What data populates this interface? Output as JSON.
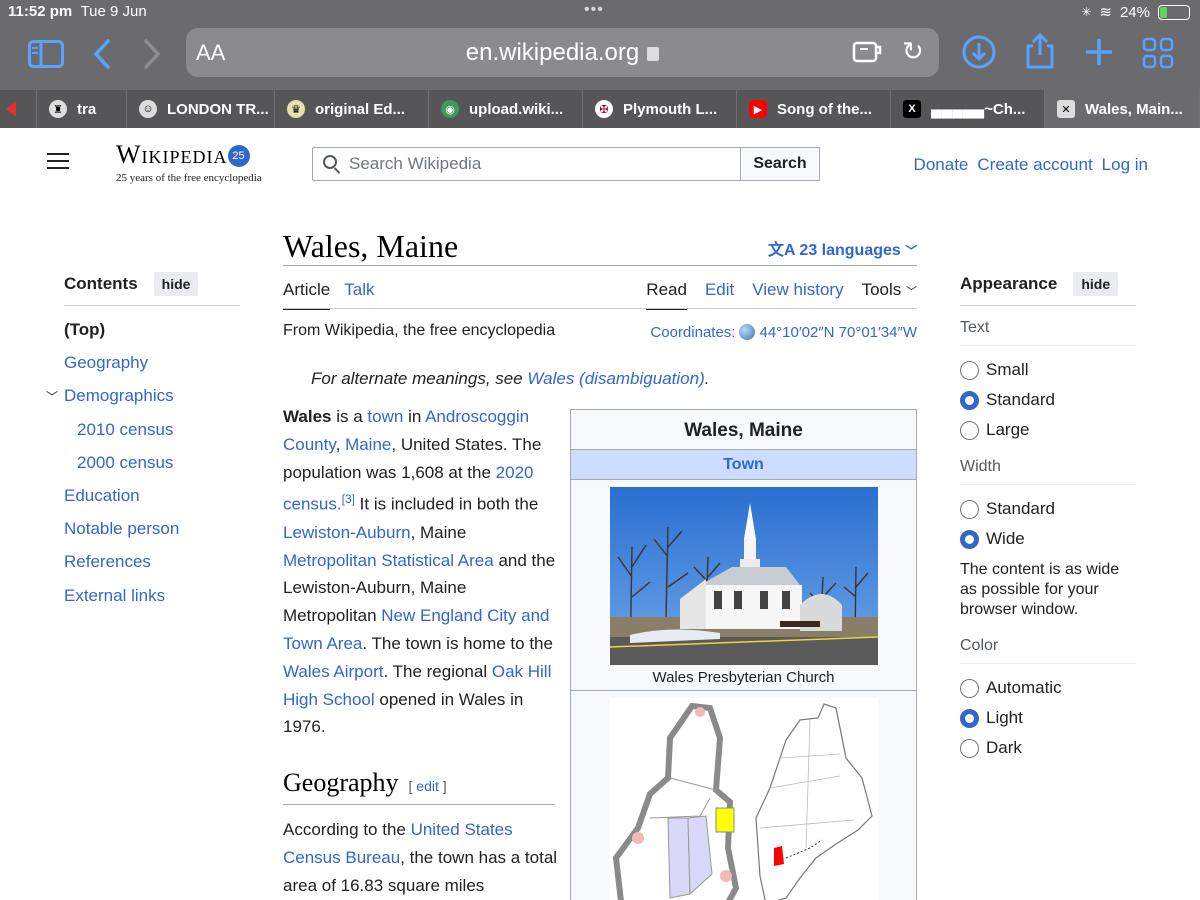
{
  "status": {
    "time": "11:52 pm",
    "date": "Tue 9 Jun",
    "battery": "24%",
    "battery_level": 0.24
  },
  "browser": {
    "aa_label": "AA",
    "url": "en.wikipedia.org",
    "tabs": [
      {
        "label": "tra",
        "icon": "trumpet-icon"
      },
      {
        "label": "LONDON TR...",
        "icon": "smiley-icon"
      },
      {
        "label": "original Ed...",
        "icon": "crest-icon"
      },
      {
        "label": "upload.wiki...",
        "icon": "wikimedia-icon"
      },
      {
        "label": "Plymouth L...",
        "icon": "badge-icon"
      },
      {
        "label": "Song of the...",
        "icon": "youtube-icon"
      },
      {
        "label": "▄▄▄▄▄~Ch...",
        "icon": "x-icon"
      },
      {
        "label": "Wales, Main...",
        "icon": "wikipedia-icon"
      }
    ]
  },
  "header": {
    "logo_word": "Wikipedia",
    "logo_badge": "25",
    "tagline": "25 years of the free encyclopedia",
    "search_placeholder": "Search Wikipedia",
    "search_button": "Search",
    "links": [
      "Donate",
      "Create account",
      "Log in"
    ]
  },
  "toc": {
    "title": "Contents",
    "hide": "hide",
    "items": [
      "(Top)",
      "Geography",
      "Demographics",
      "2010 census",
      "2000 census",
      "Education",
      "Notable person",
      "References",
      "External links"
    ]
  },
  "article": {
    "title": "Wales, Maine",
    "languages": "23 languages",
    "tabs_left": [
      "Article",
      "Talk"
    ],
    "tabs_right": [
      "Read",
      "Edit",
      "View history",
      "Tools"
    ],
    "from": "From Wikipedia, the free encyclopedia",
    "coords_label": "Coordinates:",
    "coords_value": "44°10′02″N 70°01′34″W",
    "hatnote_prefix": "For alternate meanings, see ",
    "hatnote_link": "Wales (disambiguation)",
    "hatnote_suffix": ".",
    "lead": [
      {
        "t": "Wales",
        "b": true
      },
      {
        "t": " is a "
      },
      {
        "t": "town",
        "l": true
      },
      {
        "t": " in "
      },
      {
        "t": "Androscoggin County",
        "l": true
      },
      {
        "t": ", "
      },
      {
        "t": "Maine",
        "l": true
      },
      {
        "t": ", United States. The population was 1,608 at the "
      },
      {
        "t": "2020 census",
        "l": true
      },
      {
        "t": ".",
        "l": true
      },
      {
        "t": "[3]",
        "l": true,
        "sup": true
      },
      {
        "t": " It is included in both the "
      },
      {
        "t": "Lewiston-Auburn",
        "l": true
      },
      {
        "t": ", Maine "
      },
      {
        "t": "Metropolitan Statistical Area",
        "l": true
      },
      {
        "t": " and the Lewiston-Auburn, Maine Metropolitan "
      },
      {
        "t": "New England City and Town Area",
        "l": true
      },
      {
        "t": ". The town is home to the "
      },
      {
        "t": "Wales Airport",
        "l": true
      },
      {
        "t": ". The regional "
      },
      {
        "t": "Oak Hill High School",
        "l": true
      },
      {
        "t": " opened in Wales in 1976."
      }
    ],
    "geo_heading": "Geography",
    "geo_edit": "edit",
    "geo_para": [
      {
        "t": "According to the "
      },
      {
        "t": "United States Census Bureau",
        "l": true
      },
      {
        "t": ", the town has a total area of 16.83 square miles"
      }
    ]
  },
  "infobox": {
    "title": "Wales, Maine",
    "subtitle": "Town",
    "caption": "Wales Presbyterian Church"
  },
  "appearance": {
    "title": "Appearance",
    "hide": "hide",
    "text_label": "Text",
    "text_options": [
      "Small",
      "Standard",
      "Large"
    ],
    "text_selected": "Standard",
    "width_label": "Width",
    "width_options": [
      "Standard",
      "Wide"
    ],
    "width_selected": "Wide",
    "width_desc": "The content is as wide as possible for your browser window.",
    "color_label": "Color",
    "color_options": [
      "Automatic",
      "Light",
      "Dark"
    ],
    "color_selected": "Light"
  }
}
